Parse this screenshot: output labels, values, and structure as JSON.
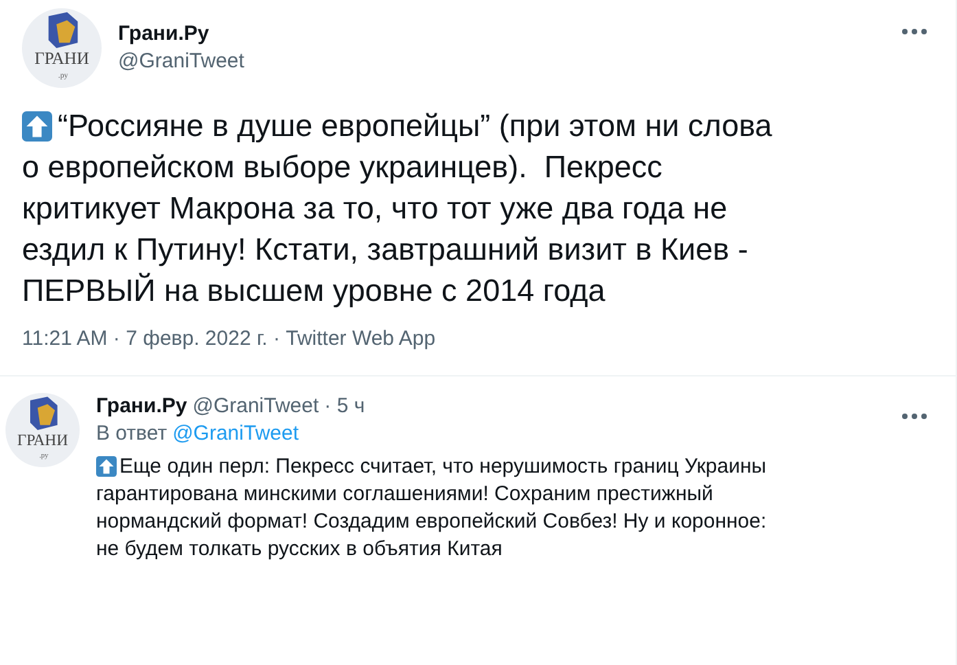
{
  "tweet": {
    "author": {
      "name": "Грани.Ру",
      "handle": "@GraniTweet",
      "logo_text": "ГРАНИ",
      "logo_sub": ".ру"
    },
    "text_lines": [
      "“Россияне в душе европейцы” (при этом ни слова",
      "о европейском выборе украинцев).  Пекресс",
      "критикует Макрона за то, что тот уже два года не",
      "ездил к Путину! Кстати, завтрашний визит в Киев -",
      "ПЕРВЫЙ на высшем уровне с 2014 года"
    ],
    "meta": "11:21 AM · 7 февр. 2022 г. · Twitter Web App"
  },
  "reply": {
    "author": {
      "name": "Грани.Ру",
      "handle": "@GraniTweet",
      "logo_text": "ГРАНИ",
      "logo_sub": ".ру"
    },
    "time": "· 5 ч",
    "reply_prefix": "В ответ",
    "reply_to": "@GraniTweet",
    "text_lines": [
      "Еще один перл: Пекресс считает, что нерушимость границ Украины",
      "гарантирована минскими соглашениями! Сохраним престижный",
      "нормандский формат! Создадим европейский Совбез! Ну и коронное:",
      "не будем толкать русских в объятия Китая"
    ]
  }
}
